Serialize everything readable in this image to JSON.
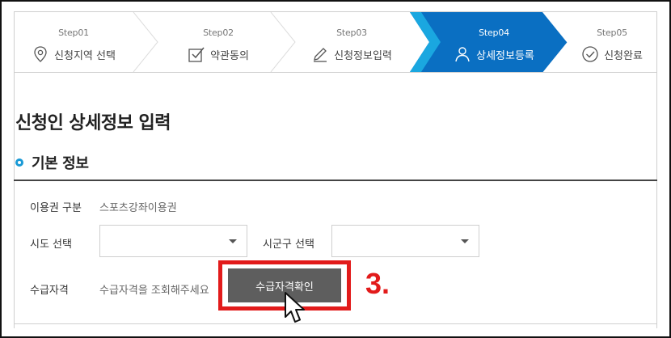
{
  "steps": [
    {
      "num": "Step01",
      "label": "신청지역 선택",
      "icon": "location-pin-icon",
      "active": false
    },
    {
      "num": "Step02",
      "label": "약관동의",
      "icon": "checkbox-icon",
      "active": false
    },
    {
      "num": "Step03",
      "label": "신청정보입력",
      "icon": "pencil-icon",
      "active": false
    },
    {
      "num": "Step04",
      "label": "상세정보등록",
      "icon": "user-icon",
      "active": true
    },
    {
      "num": "Step05",
      "label": "신청완료",
      "icon": "check-circle-icon",
      "active": false
    }
  ],
  "colors": {
    "active_step": "#0a6fc2",
    "active_step_edge": "#1aa7e0",
    "accent": "#1a9ad6",
    "button": "#5e5e5e",
    "annotation": "#e21b1b"
  },
  "page_title": "신청인 상세정보 입력",
  "section_title": "기본 정보",
  "form": {
    "voucher_type_label": "이용권 구분",
    "voucher_type_value": "스포츠강좌이용권",
    "sido_label": "시도 선택",
    "sido_value": "",
    "sigungu_label": "시군구 선택",
    "sigungu_value": "",
    "eligibility_label": "수급자격",
    "eligibility_hint": "수급자격을 조회해주세요",
    "check_button": "수급자격확인"
  },
  "annotation": "3."
}
